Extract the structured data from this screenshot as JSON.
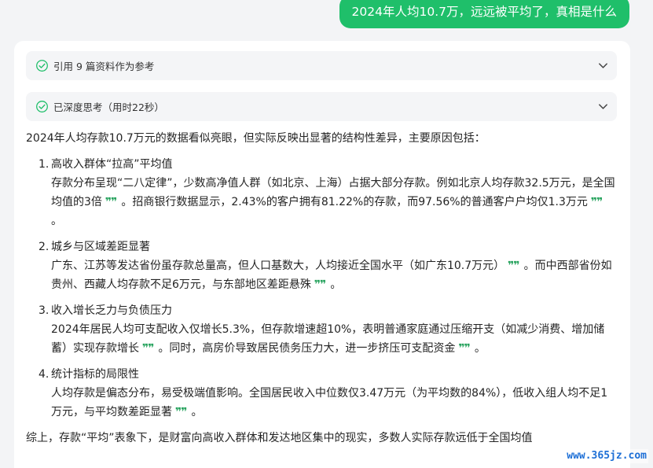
{
  "user_message": "2024年人均10.7万，远远被平均了，真相是什么",
  "references_panel": {
    "label": "引用 9 篇资料作为参考"
  },
  "thinking_panel": {
    "label": "已深度思考（用时22秒）"
  },
  "answer": {
    "intro": "2024年人均存款10.7万元的数据看似亮眼，但实际反映出显著的结构性差异，主要原因包括：",
    "items": [
      {
        "num": "1.",
        "title": "高收入群体“拉高”平均值",
        "seg1": "存款分布呈现“二八定律”，少数高净值人群（如北京、上海）占据大部分存款。例如北京人均存款32.5万元，是全国均值的3倍",
        "seg2": "。招商银行数据显示，2.43%的客户拥有81.22%的存款，而97.56%的普通客户户均仅1.3万元",
        "seg3": "。"
      },
      {
        "num": "2.",
        "title": "城乡与区域差距显著",
        "seg1": "广东、江苏等发达省份虽存款总量高，但人口基数大，人均接近全国水平（如广东10.7万元）",
        "seg2": "。而中西部省份如贵州、西藏人均存款不足6万元，与东部地区差距悬殊",
        "seg3": "。"
      },
      {
        "num": "3.",
        "title": "收入增长乏力与负债压力",
        "seg1": "2024年居民人均可支配收入仅增长5.3%，但存款增速超10%，表明普通家庭通过压缩开支（如减少消费、增加储蓄）实现存款增长",
        "seg2": "。同时，高房价导致居民债务压力大，进一步挤压可支配资金",
        "seg3": "。"
      },
      {
        "num": "4.",
        "title": "统计指标的局限性",
        "seg1": "人均存款是偏态分布，易受极端值影响。全国居民收入中位数仅3.47万元（为平均数的84%），低收入组人均不足1万元，与平均数差距显著",
        "seg2": "。"
      }
    ],
    "summary": "综上，存款“平均”表象下，是财富向高收入群体和发达地区集中的现实，多数人实际存款远低于全国均值"
  },
  "quote_mark": "❞❞",
  "watermark": "www.365jz.com",
  "colors": {
    "accent": "#1fbf6a",
    "citation": "#27a35e"
  }
}
